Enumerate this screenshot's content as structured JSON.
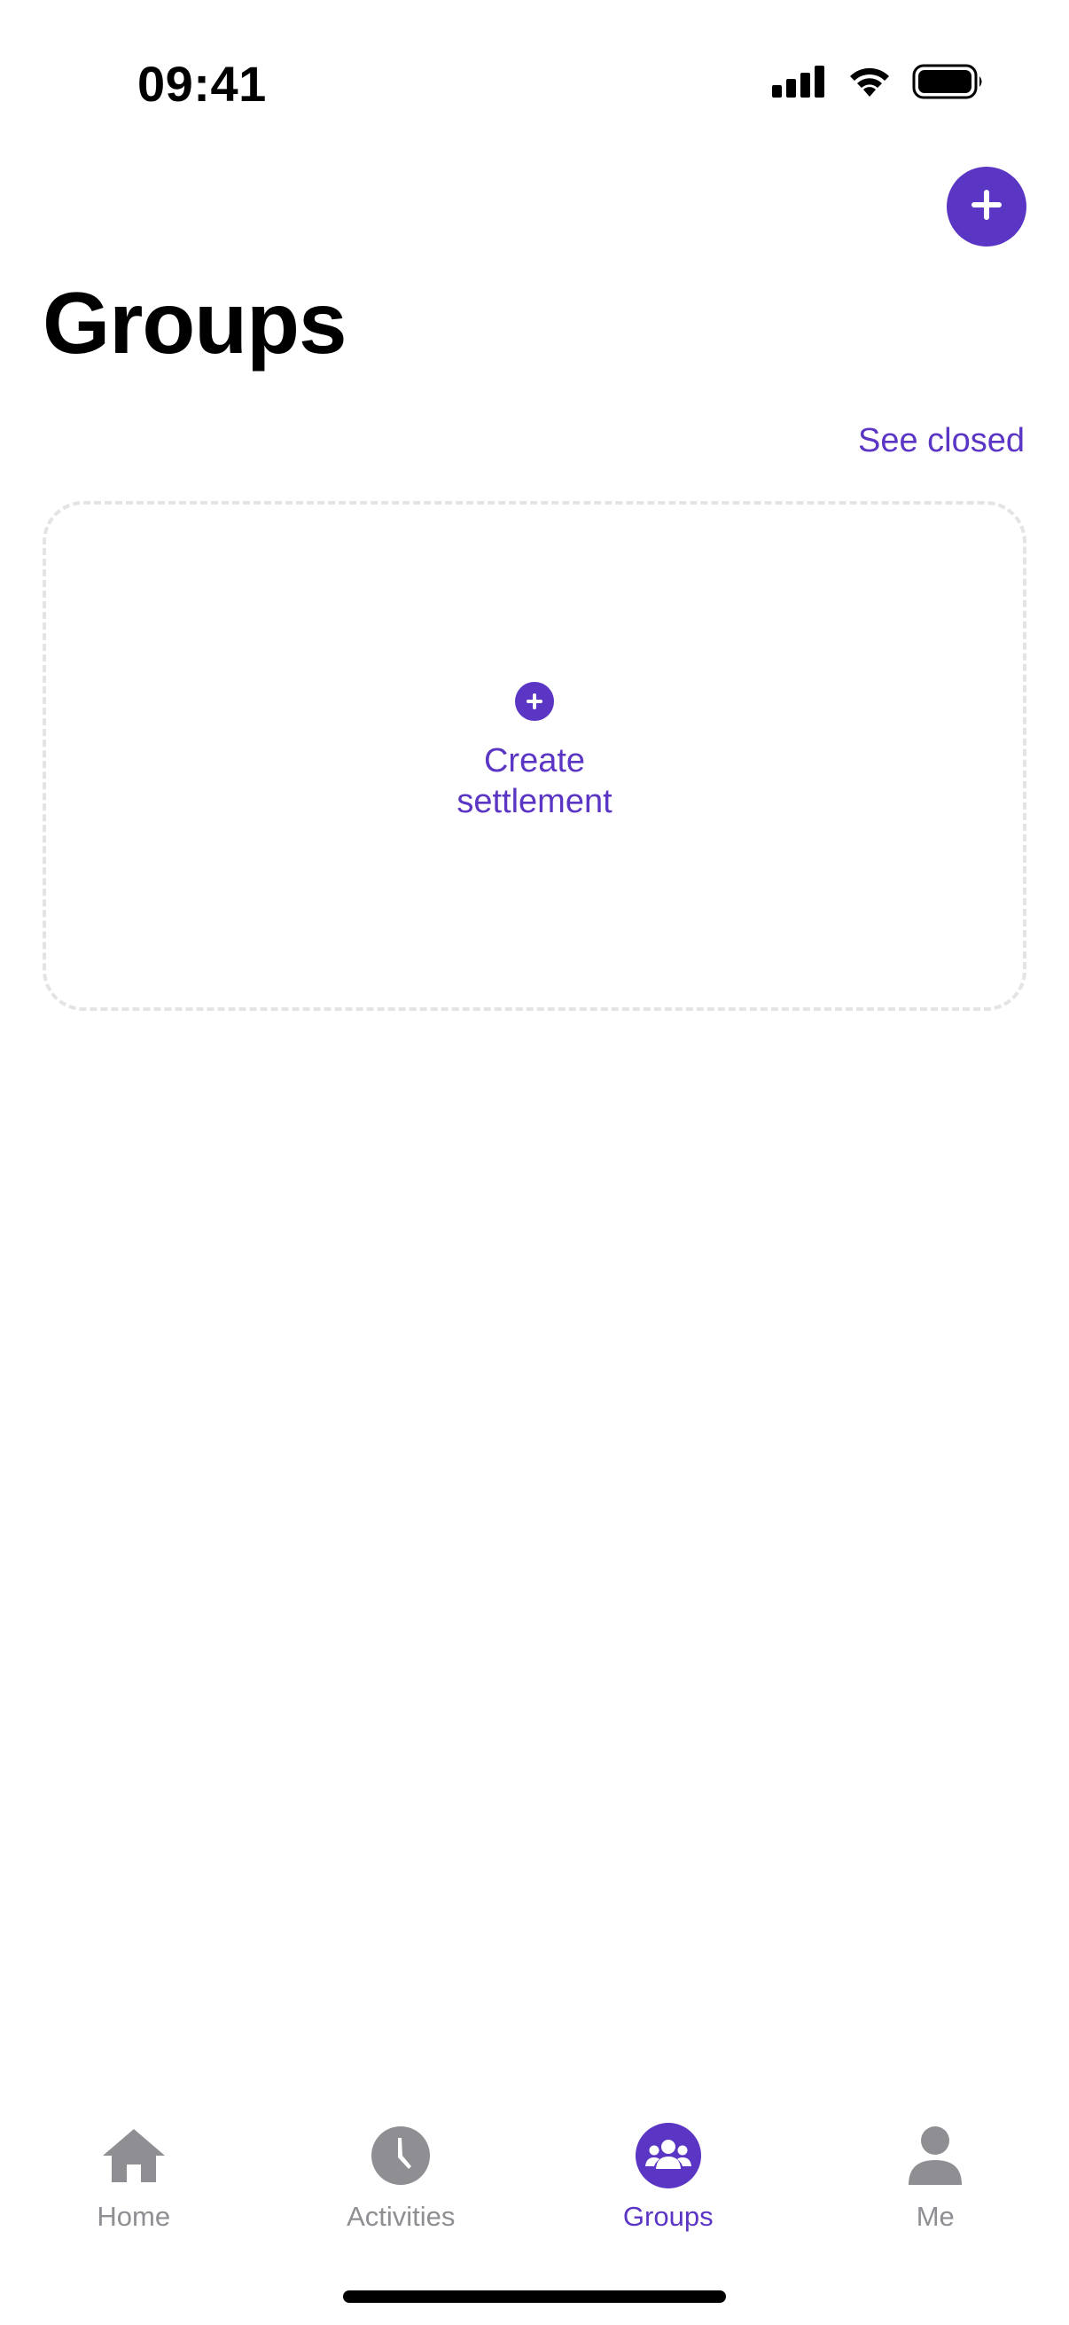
{
  "status_bar": {
    "time": "09:41"
  },
  "header": {
    "title": "Groups",
    "add_icon": "plus-icon",
    "see_closed_label": "See closed"
  },
  "create_card": {
    "icon": "plus-circle-icon",
    "label": "Create settlement"
  },
  "tab_bar": {
    "tabs": [
      {
        "label": "Home",
        "icon": "home-icon",
        "active": false
      },
      {
        "label": "Activities",
        "icon": "clock-icon",
        "active": false
      },
      {
        "label": "Groups",
        "icon": "group-icon",
        "active": true
      },
      {
        "label": "Me",
        "icon": "person-icon",
        "active": false
      }
    ]
  },
  "colors": {
    "accent": "#5b35c4",
    "inactive": "#8e8e93",
    "card_border": "#e4e4e4"
  }
}
